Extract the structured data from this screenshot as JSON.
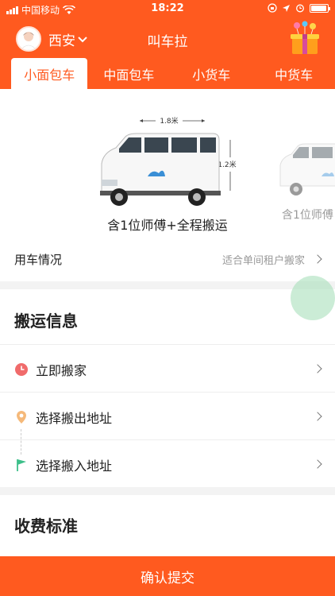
{
  "status_bar": {
    "carrier": "中国移动",
    "time": "18:22"
  },
  "header": {
    "city": "西安",
    "title": "叫车拉"
  },
  "tabs": [
    {
      "label": "小面包车",
      "active": true
    },
    {
      "label": "中面包车",
      "active": false
    },
    {
      "label": "小货车",
      "active": false
    },
    {
      "label": "中货车",
      "active": false
    }
  ],
  "vehicle": {
    "width_label": "1.8米",
    "height_label": "1.2米",
    "caption": "含1位师傅+全程搬运",
    "next_caption": "含1位师傅"
  },
  "usage": {
    "label": "用车情况",
    "value": "适合单间租户搬家"
  },
  "moving_info": {
    "title": "搬运信息",
    "items": [
      {
        "label": "立即搬家",
        "icon": "clock-icon"
      },
      {
        "label": "选择搬出地址",
        "icon": "location-pin-icon"
      },
      {
        "label": "选择搬入地址",
        "icon": "flag-icon"
      }
    ]
  },
  "fees": {
    "title": "收费标准"
  },
  "confirm_button": "确认提交",
  "colors": {
    "brand": "#ff5a1f",
    "clock": "#f06b6b",
    "pin": "#f5b97a",
    "flag": "#3dbf8a"
  }
}
